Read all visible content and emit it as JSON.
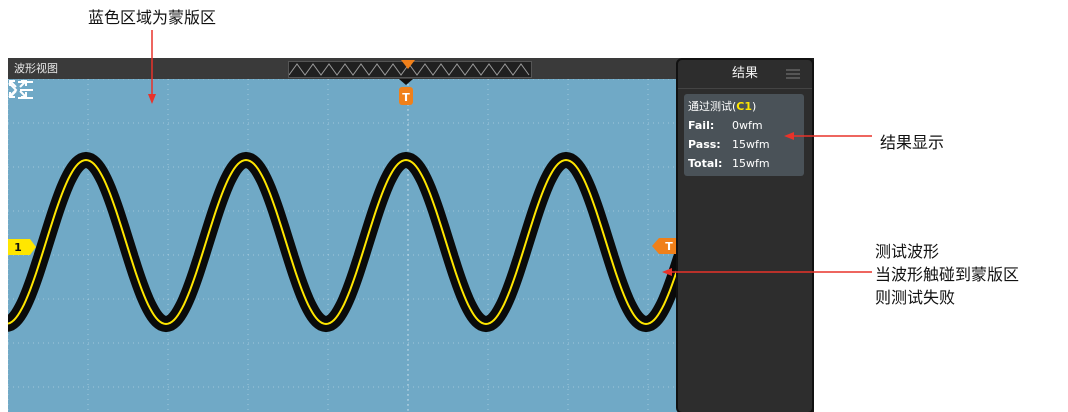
{
  "annotations": {
    "mask_label": "蓝色区域为蒙版区",
    "result_label": "结果显示",
    "test_line1": "测试波形",
    "test_line2": "当波形触碰到蒙版区",
    "test_line3": "则测试失败"
  },
  "window": {
    "title": "波形视图"
  },
  "panel": {
    "title": "结果",
    "test_name": "通过测试(",
    "channel": "C1",
    "close_paren": ")",
    "rows": [
      {
        "label": "Fail:",
        "value": "0wfm"
      },
      {
        "label": "Pass:",
        "value": "15wfm"
      },
      {
        "label": "Total:",
        "value": "15wfm"
      }
    ]
  },
  "markers": {
    "channel": "1",
    "trigger": "T",
    "trigger_level": "T"
  },
  "colors": {
    "mask": "#70a9c6",
    "waveform": "#ffe600",
    "marker": "#f0801a",
    "channel_marker": "#ffe600"
  }
}
